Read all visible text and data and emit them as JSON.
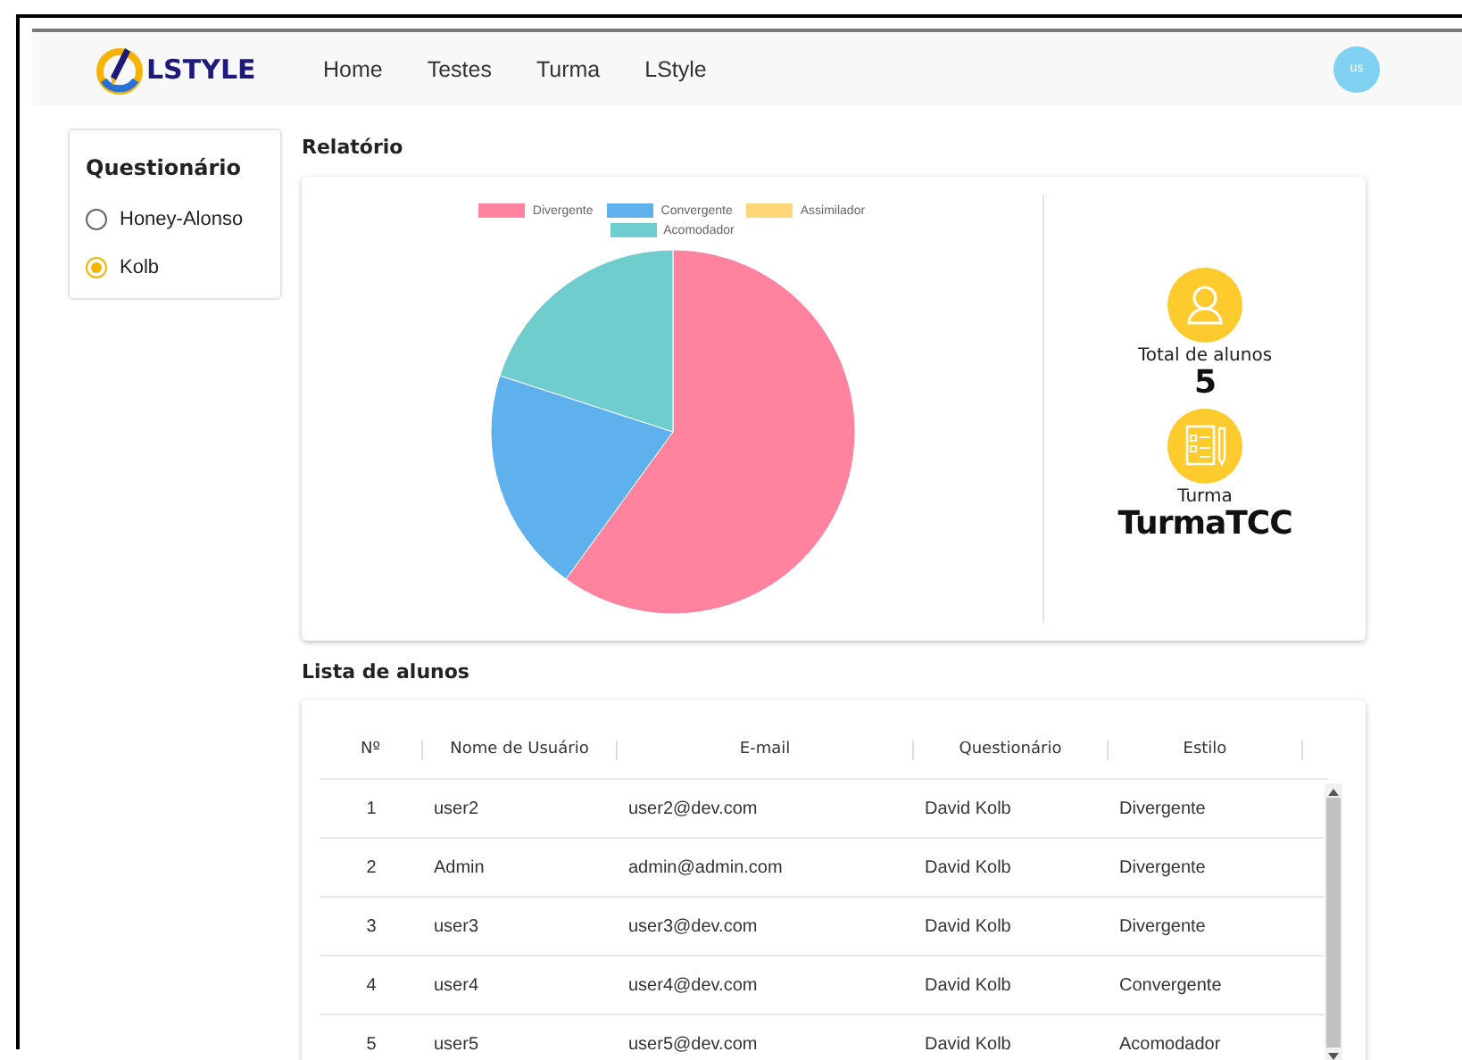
{
  "navbar": {
    "logo": "LSTYLE",
    "links": [
      {
        "label": "Home"
      },
      {
        "label": "Testes"
      },
      {
        "label": "Turma"
      },
      {
        "label": "LStyle"
      }
    ],
    "avatar": "us"
  },
  "sidebar": {
    "title": "Questionário",
    "options": [
      {
        "label": "Honey-Alonso",
        "selected": false
      },
      {
        "label": "Kolb",
        "selected": true
      }
    ]
  },
  "report": {
    "title": "Relatório",
    "chart_data": {
      "type": "pie",
      "categories": [
        "Divergente",
        "Convergente",
        "Assimilador",
        "Acomodador"
      ],
      "values": [
        60,
        20,
        0,
        20
      ],
      "legend": "top",
      "colors": [
        "#ff829e",
        "#5eb1ec",
        "#ffd778",
        "#6fcdcd"
      ]
    },
    "stats": [
      {
        "kind": "students",
        "label": "Total de alunos",
        "value": "5"
      },
      {
        "kind": "class",
        "label": "Turma",
        "value": "TurmaTCC"
      }
    ]
  },
  "students": {
    "title": "Lista de alunos",
    "columns": [
      "Nº",
      "Nome de Usuário",
      "E-mail",
      "Questionário",
      "Estilo"
    ],
    "rows": [
      [
        "1",
        "user2",
        "user2@dev.com",
        "David Kolb",
        "Divergente"
      ],
      [
        "2",
        "Admin",
        "admin@admin.com",
        "David Kolb",
        "Divergente"
      ],
      [
        "3",
        "user3",
        "user3@dev.com",
        "David Kolb",
        "Divergente"
      ],
      [
        "4",
        "user4",
        "user4@dev.com",
        "David Kolb",
        "Convergente"
      ],
      [
        "5",
        "user5",
        "user5@dev.com",
        "David Kolb",
        "Acomodador"
      ]
    ]
  }
}
